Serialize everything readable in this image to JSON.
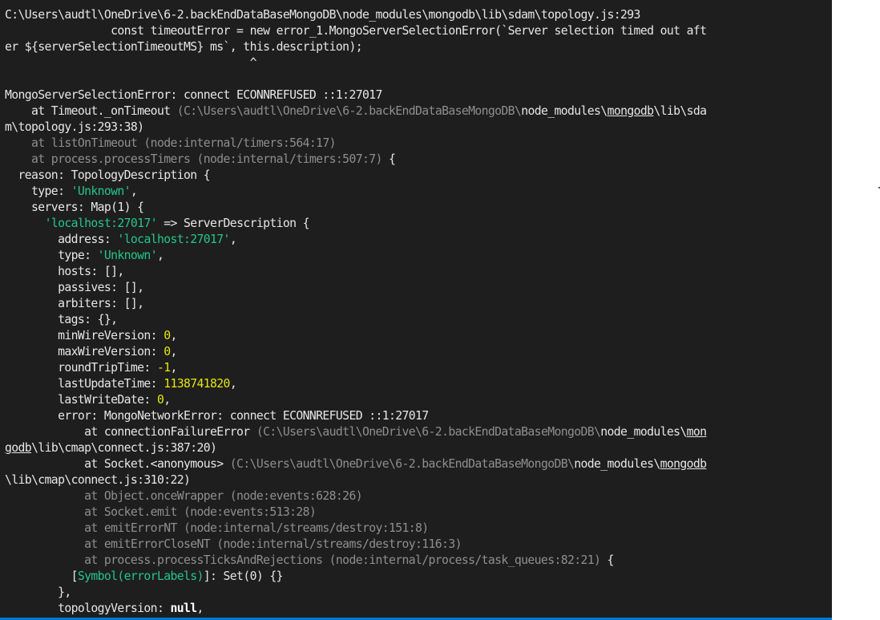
{
  "terminal": {
    "lines": [
      [
        {
          "t": "C:\\Users\\audtl\\OneDrive\\6-2.backEndDataBaseMongoDB\\node_modules\\mongodb\\lib\\sdam\\topology.js:293"
        }
      ],
      [
        {
          "t": "                const timeoutError = new error_1.MongoServerSelectionError(`Server selection timed out aft"
        }
      ],
      [
        {
          "t": "er ${serverSelectionTimeoutMS} ms`, this.description);"
        }
      ],
      [
        {
          "t": "                                     ^"
        }
      ],
      [
        {
          "t": ""
        }
      ],
      [
        {
          "t": "MongoServerSelectionError: connect ECONNREFUSED ::1:27017"
        }
      ],
      [
        {
          "t": "    at Timeout._onTimeout "
        },
        {
          "t": "(C:\\Users\\audtl\\OneDrive\\6-2.backEndDataBaseMongoDB\\",
          "s": "dim"
        },
        {
          "t": "node_modules\\"
        },
        {
          "t": "mongodb",
          "s": "ul"
        },
        {
          "t": "\\lib\\sda"
        }
      ],
      [
        {
          "t": "m\\topology.js:293:38)"
        }
      ],
      [
        {
          "t": "    at listOnTimeout (node:internal/timers:564:17)",
          "s": "dim"
        }
      ],
      [
        {
          "t": "    at process.processTimers (node:internal/timers:507:7)",
          "s": "dim"
        },
        {
          "t": " {"
        }
      ],
      [
        {
          "t": "  reason: TopologyDescription {"
        }
      ],
      [
        {
          "t": "    type: "
        },
        {
          "t": "'Unknown'",
          "s": "str"
        },
        {
          "t": ","
        }
      ],
      [
        {
          "t": "    servers: Map(1) {"
        }
      ],
      [
        {
          "t": "      "
        },
        {
          "t": "'localhost:27017'",
          "s": "str"
        },
        {
          "t": " => ServerDescription {"
        }
      ],
      [
        {
          "t": "        address: "
        },
        {
          "t": "'localhost:27017'",
          "s": "str"
        },
        {
          "t": ","
        }
      ],
      [
        {
          "t": "        type: "
        },
        {
          "t": "'Unknown'",
          "s": "str"
        },
        {
          "t": ","
        }
      ],
      [
        {
          "t": "        hosts: [],"
        }
      ],
      [
        {
          "t": "        passives: [],"
        }
      ],
      [
        {
          "t": "        arbiters: [],"
        }
      ],
      [
        {
          "t": "        tags: {},"
        }
      ],
      [
        {
          "t": "        minWireVersion: "
        },
        {
          "t": "0",
          "s": "num"
        },
        {
          "t": ","
        }
      ],
      [
        {
          "t": "        maxWireVersion: "
        },
        {
          "t": "0",
          "s": "num"
        },
        {
          "t": ","
        }
      ],
      [
        {
          "t": "        roundTripTime: "
        },
        {
          "t": "-1",
          "s": "num"
        },
        {
          "t": ","
        }
      ],
      [
        {
          "t": "        lastUpdateTime: "
        },
        {
          "t": "1138741820",
          "s": "num"
        },
        {
          "t": ","
        }
      ],
      [
        {
          "t": "        lastWriteDate: "
        },
        {
          "t": "0",
          "s": "num"
        },
        {
          "t": ","
        }
      ],
      [
        {
          "t": "        error: MongoNetworkError: connect ECONNREFUSED ::1:27017"
        }
      ],
      [
        {
          "t": "            at connectionFailureError "
        },
        {
          "t": "(C:\\Users\\audtl\\OneDrive\\6-2.backEndDataBaseMongoDB\\",
          "s": "dim"
        },
        {
          "t": "node_modules\\"
        },
        {
          "t": "mon",
          "s": "ul"
        }
      ],
      [
        {
          "t": "godb",
          "s": "ul"
        },
        {
          "t": "\\lib\\cmap\\connect.js:387:20)"
        }
      ],
      [
        {
          "t": "            at Socket.<anonymous> "
        },
        {
          "t": "(C:\\Users\\audtl\\OneDrive\\6-2.backEndDataBaseMongoDB\\",
          "s": "dim"
        },
        {
          "t": "node_modules\\"
        },
        {
          "t": "mongodb",
          "s": "ul"
        }
      ],
      [
        {
          "t": "\\lib\\cmap\\connect.js:310:22)"
        }
      ],
      [
        {
          "t": "            at Object.onceWrapper (node:events:628:26)",
          "s": "dim"
        }
      ],
      [
        {
          "t": "            at Socket.emit (node:events:513:28)",
          "s": "dim"
        }
      ],
      [
        {
          "t": "            at emitErrorNT (node:internal/streams/destroy:151:8)",
          "s": "dim"
        }
      ],
      [
        {
          "t": "            at emitErrorCloseNT (node:internal/streams/destroy:116:3)",
          "s": "dim"
        }
      ],
      [
        {
          "t": "            at process.processTicksAndRejections (node:internal/process/task_queues:82:21)",
          "s": "dim"
        },
        {
          "t": " {"
        }
      ],
      [
        {
          "t": "          ["
        },
        {
          "t": "Symbol(errorLabels)",
          "s": "sym"
        },
        {
          "t": "]: Set(0) {}"
        }
      ],
      [
        {
          "t": "        },"
        }
      ],
      [
        {
          "t": "        topologyVersion: "
        },
        {
          "t": "null",
          "s": "bold"
        },
        {
          "t": ","
        }
      ]
    ]
  },
  "colors": {
    "background": "#1e1e1e",
    "text": "#e6e6e6",
    "dim_text": "#8e8e8e",
    "string": "#23c68a",
    "number": "#e5e510",
    "status_bar": "#007acc"
  }
}
